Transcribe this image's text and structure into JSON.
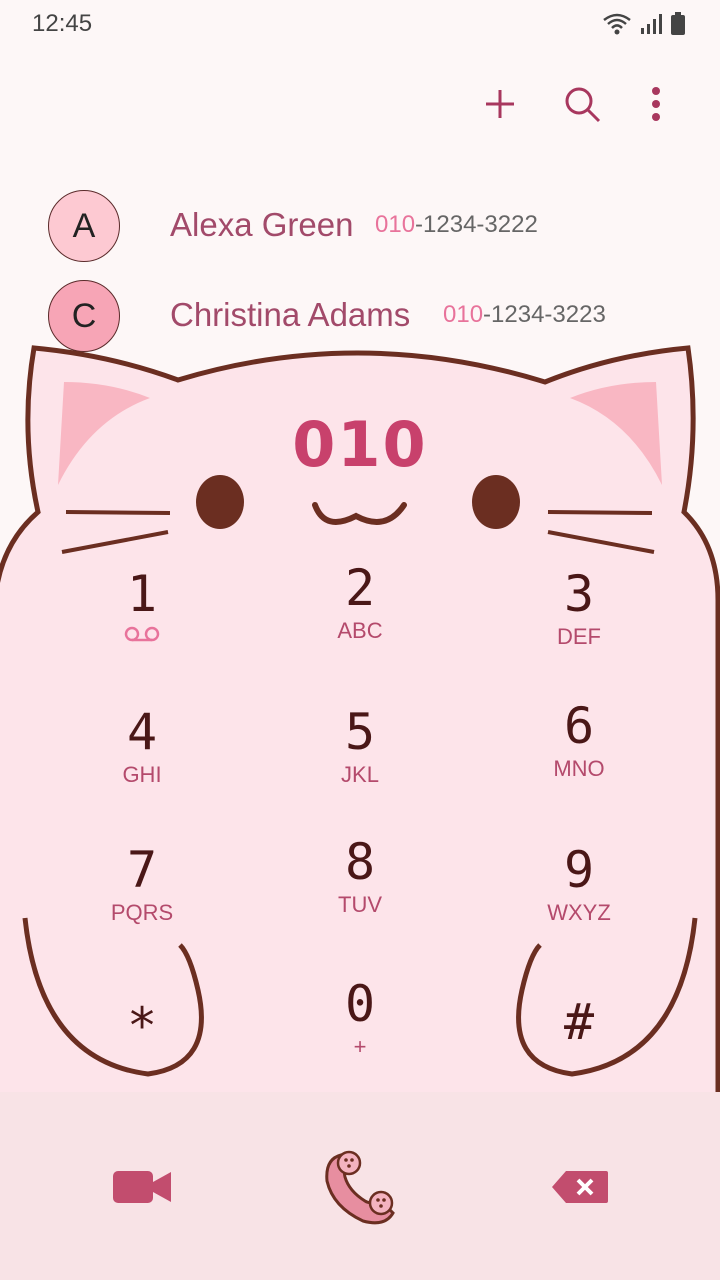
{
  "status_bar": {
    "time": "12:45"
  },
  "toolbar": {
    "add_icon": "plus-icon",
    "search_icon": "search-icon",
    "menu_icon": "more-vert-icon"
  },
  "contacts": [
    {
      "initial": "A",
      "name": "Alexa Green",
      "number_match": "010",
      "number_rest": "-1234-3222"
    },
    {
      "initial": "C",
      "name": "Christina Adams",
      "number_match": "010",
      "number_rest": "-1234-3223"
    }
  ],
  "dialer": {
    "entered_digits": "010",
    "keys": [
      {
        "num": "1",
        "letters": ""
      },
      {
        "num": "2",
        "letters": "ABC"
      },
      {
        "num": "3",
        "letters": "DEF"
      },
      {
        "num": "4",
        "letters": "GHI"
      },
      {
        "num": "5",
        "letters": "JKL"
      },
      {
        "num": "6",
        "letters": "MNO"
      },
      {
        "num": "7",
        "letters": "PQRS"
      },
      {
        "num": "8",
        "letters": "TUV"
      },
      {
        "num": "9",
        "letters": "WXYZ"
      },
      {
        "num": "*",
        "letters": ""
      },
      {
        "num": "0",
        "letters": "+"
      },
      {
        "num": "#",
        "letters": ""
      }
    ]
  },
  "bottom_bar": {
    "video_icon": "video-call-icon",
    "call_icon": "phone-call-icon",
    "backspace_icon": "backspace-icon"
  },
  "colors": {
    "accent": "#c8416c",
    "cat_fill": "#fde4ea",
    "outline": "#6b2e21",
    "bottom_bg": "#f8e3e6"
  }
}
